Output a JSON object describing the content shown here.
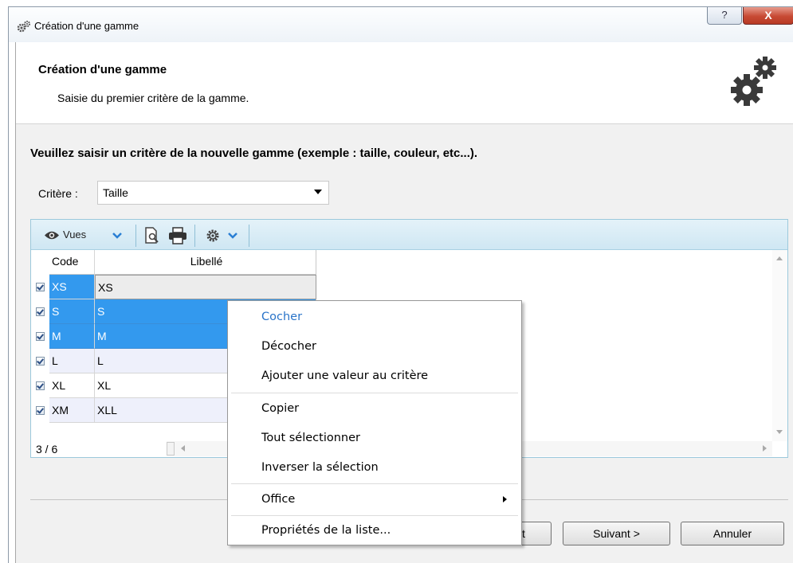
{
  "window": {
    "title": "Création d'une gamme",
    "help_label": "?",
    "close_label": "X"
  },
  "header": {
    "title": "Création d'une gamme",
    "subtitle": "Saisie du premier critère de la gamme."
  },
  "instruction": "Veuillez saisir un critère de la nouvelle gamme (exemple : taille, couleur, etc...).",
  "criterion": {
    "label": "Critère :",
    "value": "Taille"
  },
  "toolbar": {
    "views_label": "Vues"
  },
  "grid": {
    "columns": [
      "Code",
      "Libellé"
    ],
    "rows": [
      {
        "code": "XS",
        "libelle": "XS"
      },
      {
        "code": "S",
        "libelle": "S"
      },
      {
        "code": "M",
        "libelle": "M"
      },
      {
        "code": "L",
        "libelle": "L"
      },
      {
        "code": "XL",
        "libelle": "XL"
      },
      {
        "code": "XM",
        "libelle": "XLL"
      }
    ],
    "count": "3 / 6"
  },
  "buttons": {
    "prev_visible": "t",
    "next": "Suivant >",
    "cancel": "Annuler"
  },
  "context_menu": {
    "items": [
      "Cocher",
      "Décocher",
      "Ajouter une valeur au critère",
      "Copier",
      "Tout sélectionner",
      "Inverser la sélection",
      "Office",
      "Propriétés de la liste..."
    ]
  },
  "colors": {
    "selection": "#3399ee",
    "toolbar": "#cfe7f3",
    "menu_highlight_text": "#2a74c9"
  }
}
